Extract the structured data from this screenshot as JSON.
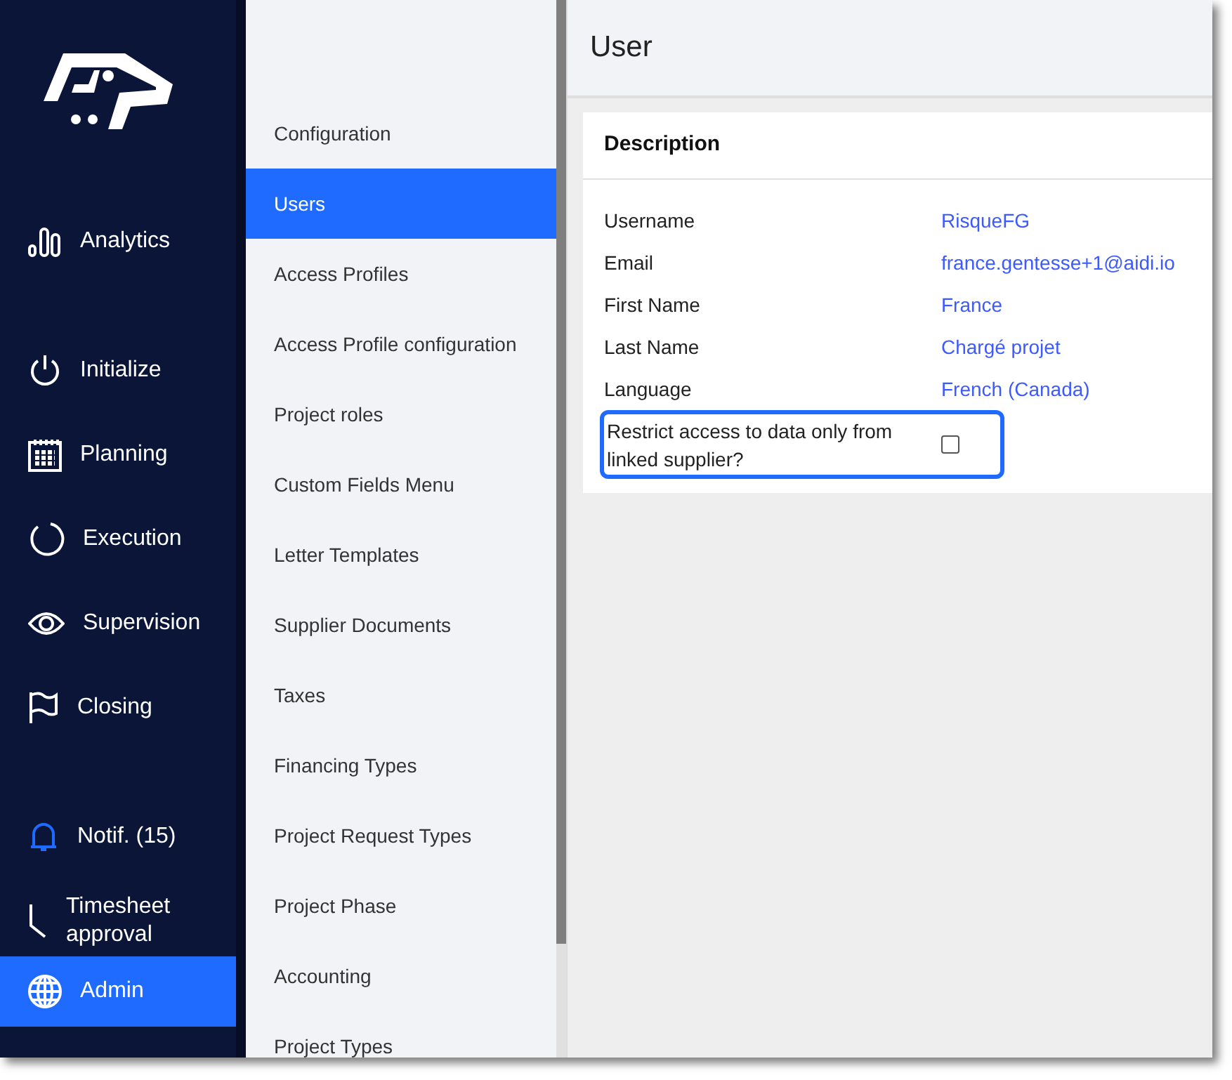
{
  "sidebar": {
    "items": [
      {
        "label": "Analytics",
        "selected": false
      },
      {
        "label": "Initialize",
        "selected": false
      },
      {
        "label": "Planning",
        "selected": false
      },
      {
        "label": "Execution",
        "selected": false
      },
      {
        "label": "Supervision",
        "selected": false
      },
      {
        "label": "Closing",
        "selected": false
      },
      {
        "label": "Notif. (15)",
        "selected": false
      },
      {
        "label": "Timesheet approval",
        "selected": false
      },
      {
        "label": "Admin",
        "selected": true
      }
    ]
  },
  "submenu": {
    "items": [
      {
        "label": "Configuration",
        "selected": false
      },
      {
        "label": "Users",
        "selected": true
      },
      {
        "label": "Access Profiles",
        "selected": false
      },
      {
        "label": "Access Profile configuration",
        "selected": false
      },
      {
        "label": "Project roles",
        "selected": false
      },
      {
        "label": "Custom Fields Menu",
        "selected": false
      },
      {
        "label": "Letter Templates",
        "selected": false
      },
      {
        "label": "Supplier Documents",
        "selected": false
      },
      {
        "label": "Taxes",
        "selected": false
      },
      {
        "label": "Financing Types",
        "selected": false
      },
      {
        "label": "Project Request Types",
        "selected": false
      },
      {
        "label": "Project Phase",
        "selected": false
      },
      {
        "label": "Accounting",
        "selected": false
      },
      {
        "label": "Project Types",
        "selected": false
      }
    ]
  },
  "page": {
    "title": "User"
  },
  "card": {
    "title": "Description",
    "fields": [
      {
        "kind": "text",
        "label": "Username",
        "value": "RisqueFG"
      },
      {
        "kind": "text",
        "label": "Email",
        "value": "france.gentesse+1@aidi.io"
      },
      {
        "kind": "text",
        "label": "First Name",
        "value": "France"
      },
      {
        "kind": "text",
        "label": "Last Name",
        "value": "Chargé projet"
      },
      {
        "kind": "text",
        "label": "Language",
        "value": "French (Canada)"
      },
      {
        "kind": "checkbox",
        "label": "Restrict access to data only from linked supplier?",
        "checked": false,
        "focused": true
      }
    ]
  }
}
